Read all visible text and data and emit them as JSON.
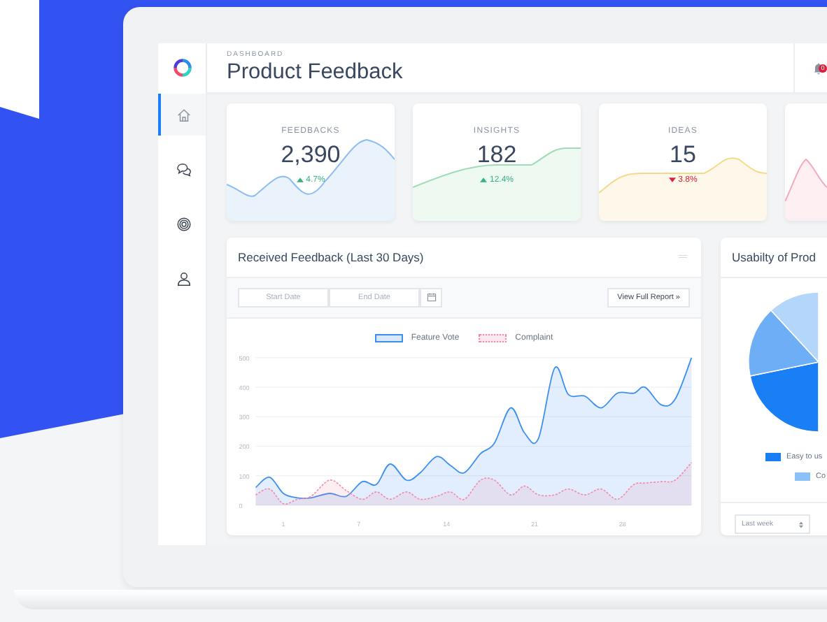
{
  "sidebar": {
    "items": [
      {
        "kind": "home",
        "selected": true
      },
      {
        "kind": "chat",
        "selected": false
      },
      {
        "kind": "target",
        "selected": false
      },
      {
        "kind": "user",
        "selected": false
      }
    ]
  },
  "header": {
    "overline": "DASHBOARD",
    "title": "Product Feedback",
    "notifications": "0"
  },
  "cards": [
    {
      "label": "FEEDBACKS",
      "value": "2,390",
      "change": "4.7%",
      "kind": "up",
      "color": "#8cbcf0"
    },
    {
      "label": "INSIGHTS",
      "value": "182",
      "change": "12.4%",
      "kind": "up",
      "color": "#9fdcb4"
    },
    {
      "label": "IDEAS",
      "value": "15",
      "change": "3.8%",
      "kind": "down",
      "color": "#f5d98a"
    },
    {
      "color": "#f5a9b8"
    }
  ],
  "feedback_panel": {
    "title": "Received Feedback (Last 30 Days)",
    "start_date": {
      "placeholder": "Start Date"
    },
    "end_date": {
      "placeholder": "End Date"
    },
    "report_button": "View Full Report »",
    "chart_data": {
      "type": "area",
      "grid": true,
      "xlim": [
        -1.2,
        33.5
      ],
      "ylim": [
        0,
        500
      ],
      "xticks": [
        1,
        7,
        14,
        21,
        28
      ],
      "yticks": [
        0,
        100,
        200,
        300,
        400,
        500
      ],
      "x": [
        -1.2,
        -0.1,
        1,
        2.1,
        3.2,
        4.7,
        6,
        7.3,
        8.4,
        9.5,
        10.8,
        11.9,
        13.2,
        14.3,
        15.4,
        16.7,
        17.8,
        19.1,
        20.2,
        21.3,
        22.6,
        23.7,
        25,
        26.3,
        27.6,
        28.9,
        29.8,
        31.1,
        32.2,
        33.5
      ],
      "series": [
        {
          "name": "Feature Vote",
          "color": "#3b8ff0",
          "values": [
            60,
            95,
            40,
            25,
            25,
            40,
            30,
            80,
            70,
            140,
            85,
            110,
            165,
            135,
            110,
            175,
            210,
            330,
            245,
            225,
            465,
            375,
            370,
            330,
            380,
            380,
            400,
            340,
            360,
            500
          ]
        },
        {
          "name": "Complaint",
          "color": "#f08aa8",
          "values": [
            35,
            55,
            5,
            20,
            30,
            85,
            50,
            20,
            45,
            20,
            45,
            20,
            30,
            45,
            20,
            85,
            85,
            35,
            65,
            35,
            35,
            55,
            35,
            55,
            20,
            70,
            75,
            80,
            85,
            145
          ]
        }
      ]
    }
  },
  "usability_panel": {
    "title": "Usabilty of Prod",
    "legend": [
      {
        "label": "Easy to us",
        "color": "#1a7ff5"
      },
      {
        "label": "Co",
        "color": "#8cc0f8"
      }
    ],
    "period_select": "Last week"
  }
}
